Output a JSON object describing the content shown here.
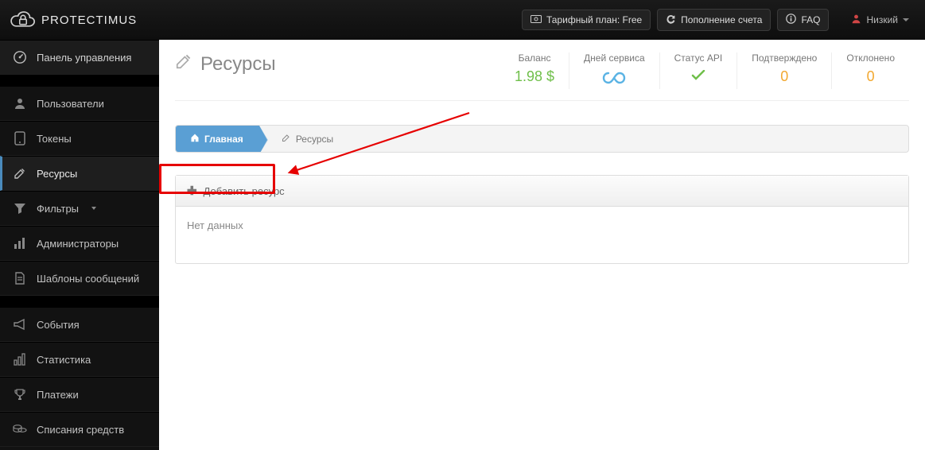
{
  "brand": "PROTECTIMUS",
  "topbar": {
    "tariff": "Тарифный план: Free",
    "topup": "Пополнение счета",
    "faq": "FAQ",
    "user": "Низкий"
  },
  "sidebar": {
    "dashboard": "Панель управления",
    "users": "Пользователи",
    "tokens": "Токены",
    "resources": "Ресурсы",
    "filters": "Фильтры",
    "admins": "Администраторы",
    "templates": "Шаблоны сообщений",
    "events": "События",
    "stats": "Статистика",
    "payments": "Платежи",
    "writeoffs": "Списания средств"
  },
  "page": {
    "title": "Ресурсы",
    "stats": {
      "balance_label": "Баланс",
      "balance_value": "1.98 $",
      "days_label": "Дней сервиса",
      "days_value": "∞",
      "api_label": "Статус API",
      "confirmed_label": "Подтверждено",
      "confirmed_value": "0",
      "rejected_label": "Отклонено",
      "rejected_value": "0"
    },
    "crumb_home": "Главная",
    "crumb_resources": "Ресурсы",
    "add_resource": "Добавить ресурс",
    "no_data": "Нет данных"
  }
}
